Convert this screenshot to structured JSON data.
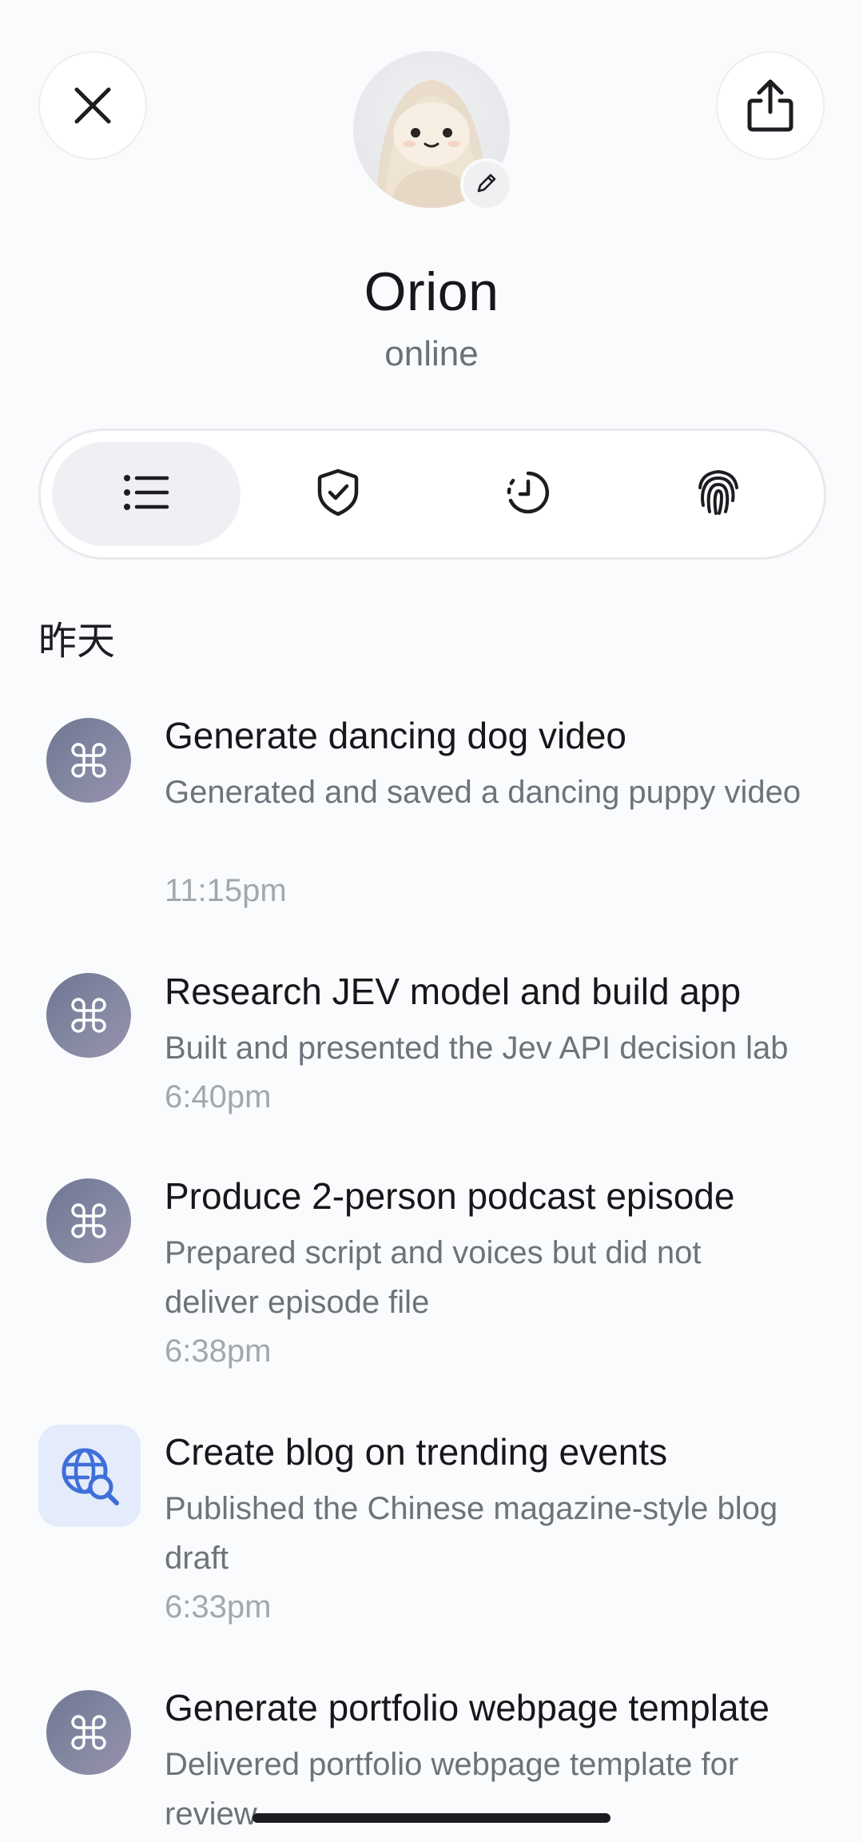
{
  "header": {
    "close_icon": "close-icon",
    "share_icon": "share-icon",
    "edit_icon": "pencil-icon"
  },
  "profile": {
    "name": "Orion",
    "status": "online"
  },
  "tabs": [
    {
      "icon": "list-icon",
      "active": true
    },
    {
      "icon": "shield-check-icon",
      "active": false
    },
    {
      "icon": "clock-history-icon",
      "active": false
    },
    {
      "icon": "fingerprint-icon",
      "active": false
    }
  ],
  "section": {
    "label": "昨天"
  },
  "tasks": [
    {
      "icon": "command-icon",
      "title": "Generate dancing dog video",
      "description": "Generated and saved a dancing puppy video",
      "time": "11:15pm"
    },
    {
      "icon": "command-icon",
      "title": "Research JEV model and build app",
      "description": "Built and presented the Jev API decision lab",
      "time": "6:40pm"
    },
    {
      "icon": "command-icon",
      "title": "Produce 2-person podcast episode",
      "description": "Prepared script and voices but did not deliver episode file",
      "time": "6:38pm"
    },
    {
      "icon": "globe-search-icon",
      "title": "Create blog on trending events",
      "description": "Published the Chinese magazine-style blog draft",
      "time": "6:33pm"
    },
    {
      "icon": "command-icon",
      "title": "Generate portfolio webpage template",
      "description": "Delivered portfolio webpage template for review",
      "time": ""
    }
  ],
  "colors": {
    "background": "#fafbfc",
    "text_primary": "#15171a",
    "text_secondary": "#6e727b",
    "text_muted": "#a3a7ae",
    "task_icon": "#7a7f9b",
    "globe_icon": "#3f6fd8",
    "active_tab": "#eef0f3"
  }
}
